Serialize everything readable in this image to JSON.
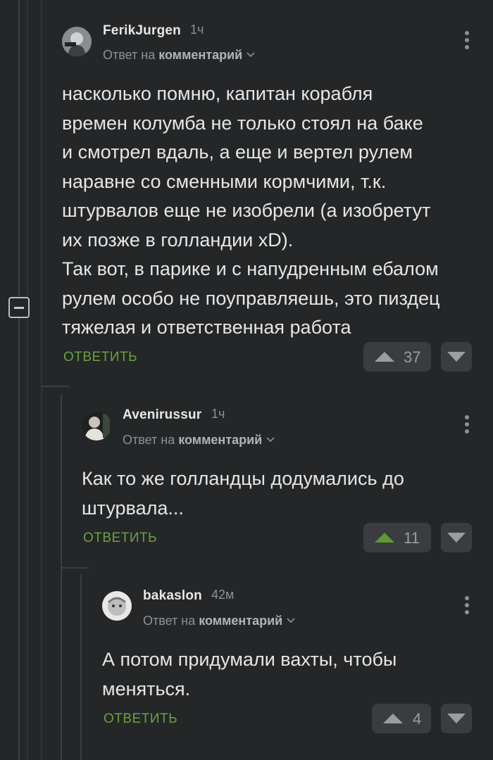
{
  "comments": [
    {
      "username": "FerikJurgen",
      "time": "1ч",
      "reply_prefix": "Ответ на",
      "reply_target": "комментарий",
      "text": "насколько помню, капитан корабля\nвремен колумба не только стоял на баке\nи смотрел вдаль, а еще и вертел рулем\nнаравне со сменными кормчими, т.к.\nштурвалов еще не изобрели (а изобретут\nих позже в голландии xD).\nТак вот, в парике и с напудренным ебалом\nрулем особо не поуправляешь, это пиздец\nтяжелая и ответственная работа",
      "reply_label": "ОТВЕТИТЬ",
      "votes": "37",
      "upvoted": false
    },
    {
      "username": "Avenirussur",
      "time": "1ч",
      "reply_prefix": "Ответ на",
      "reply_target": "комментарий",
      "text": "Как то же голландцы додумались до\nштурвала...",
      "reply_label": "ОТВЕТИТЬ",
      "votes": "11",
      "upvoted": true
    },
    {
      "username": "bakaslon",
      "time": "42м",
      "reply_prefix": "Ответ на",
      "reply_target": "комментарий",
      "text": "А потом придумали вахты, чтобы\nменяться.",
      "reply_label": "ОТВЕТИТЬ",
      "votes": "4",
      "upvoted": false
    }
  ],
  "colors": {
    "background": "#242628",
    "accent_green": "#6aa240",
    "button_bg": "#3a3c40",
    "muted_text": "#8e9196"
  },
  "icons": [
    "menu-dots-icon",
    "chevron-down-icon",
    "upvote-arrow-icon",
    "downvote-arrow-icon",
    "collapse-minus-icon"
  ]
}
